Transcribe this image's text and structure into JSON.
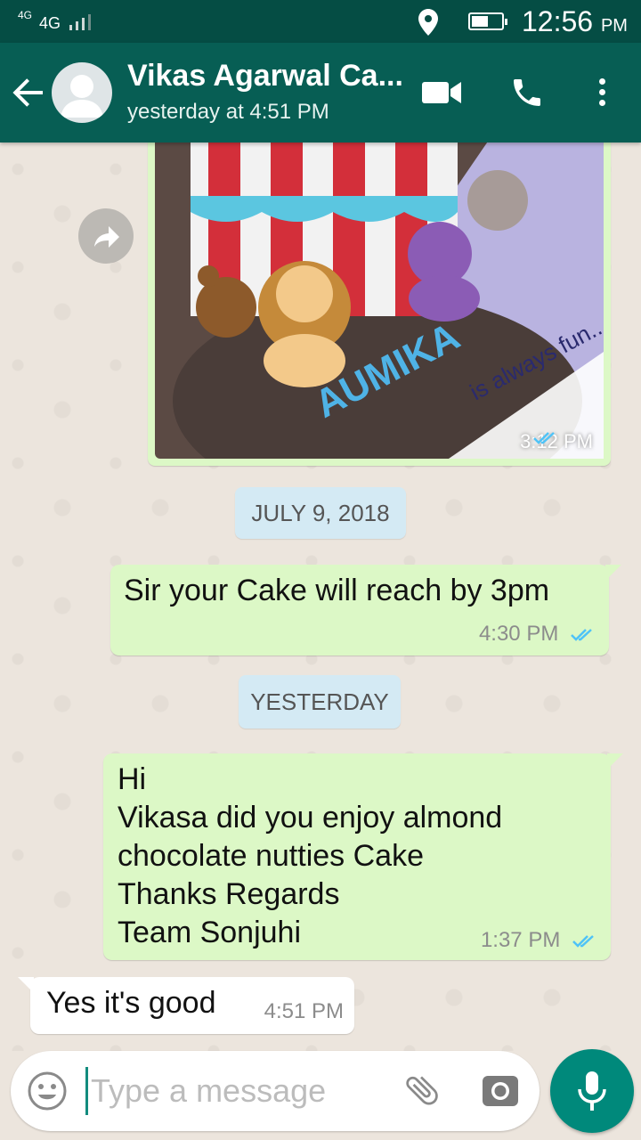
{
  "status_bar": {
    "net_small": "4G",
    "net_large": "4G",
    "time": "12:56",
    "ampm": "PM"
  },
  "header": {
    "contact_name": "Vikas Agarwal Ca...",
    "last_seen": "yesterday at 4:51 PM"
  },
  "messages": {
    "image": {
      "time": "3:12 PM",
      "status": "read"
    },
    "date1": "JULY 9, 2018",
    "m1": {
      "text": "Sir  your Cake will  reach by  3pm",
      "time": "4:30 PM",
      "status": "read"
    },
    "date2": "YESTERDAY",
    "m2": {
      "text": "Hi\nVikasa  did you enjoy almond\nchocolate nutties Cake\nThanks Regards\nTeam Sonjuhi",
      "time": "1:37 PM",
      "status": "read"
    },
    "m3": {
      "text": "Yes it's good",
      "time": "4:51 PM"
    }
  },
  "composer": {
    "placeholder": "Type a message"
  },
  "colors": {
    "header": "#075e54",
    "status_bar": "#054d44",
    "outgoing_bubble": "#dcf8c6",
    "incoming_bubble": "#ffffff",
    "read_ticks": "#4fc3f7",
    "accent": "#00897b"
  },
  "icons": [
    "back-arrow-icon",
    "avatar-placeholder-icon",
    "video-call-icon",
    "phone-icon",
    "more-vert-icon",
    "forward-icon",
    "emoji-icon",
    "attach-icon",
    "camera-icon",
    "mic-icon",
    "location-icon",
    "battery-icon",
    "signal-icon"
  ]
}
